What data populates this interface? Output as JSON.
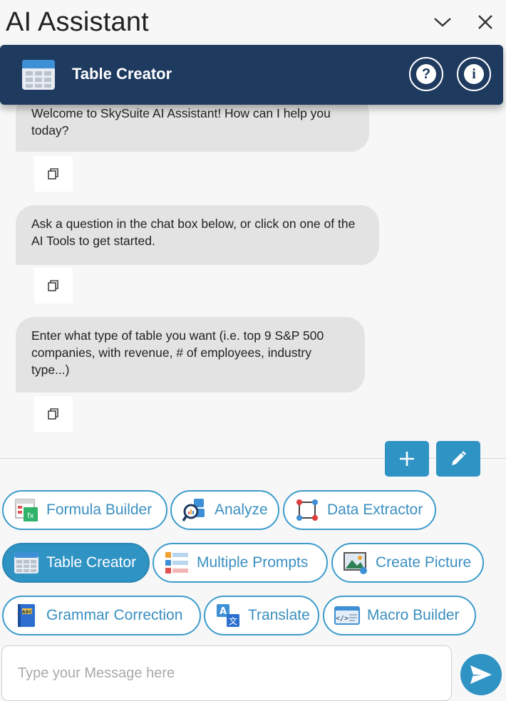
{
  "window": {
    "title": "AI Assistant"
  },
  "header": {
    "tool_title": "Table Creator",
    "help_glyph": "?",
    "info_glyph": "i"
  },
  "chat": {
    "messages": [
      {
        "text": "Welcome to SkySuite AI Assistant! How can I help you today?"
      },
      {
        "text": "Ask a question in the chat box below, or click on one of the AI Tools to get started."
      },
      {
        "text": "Enter what type of table you want (i.e. top 9 S&P 500 companies, with revenue, # of employees, industry type...)"
      }
    ]
  },
  "tools": [
    {
      "label": "Formula Builder",
      "icon": "formula-builder-icon"
    },
    {
      "label": "Analyze",
      "icon": "analyze-icon"
    },
    {
      "label": "Data Extractor",
      "icon": "data-extractor-icon"
    },
    {
      "label": "Table Creator",
      "icon": "table-icon",
      "active": true
    },
    {
      "label": "Multiple Prompts",
      "icon": "multiple-prompts-icon"
    },
    {
      "label": "Create Picture",
      "icon": "create-picture-icon"
    },
    {
      "label": "Grammar Correction",
      "icon": "grammar-book-icon"
    },
    {
      "label": "Translate",
      "icon": "translate-icon"
    },
    {
      "label": "Macro Builder",
      "icon": "macro-code-icon"
    }
  ],
  "input": {
    "placeholder": "Type your Message here",
    "value": ""
  },
  "colors": {
    "header_bg": "#1e3a5f",
    "accent": "#2f93c4",
    "bubble_bg": "#e3e3e3"
  }
}
